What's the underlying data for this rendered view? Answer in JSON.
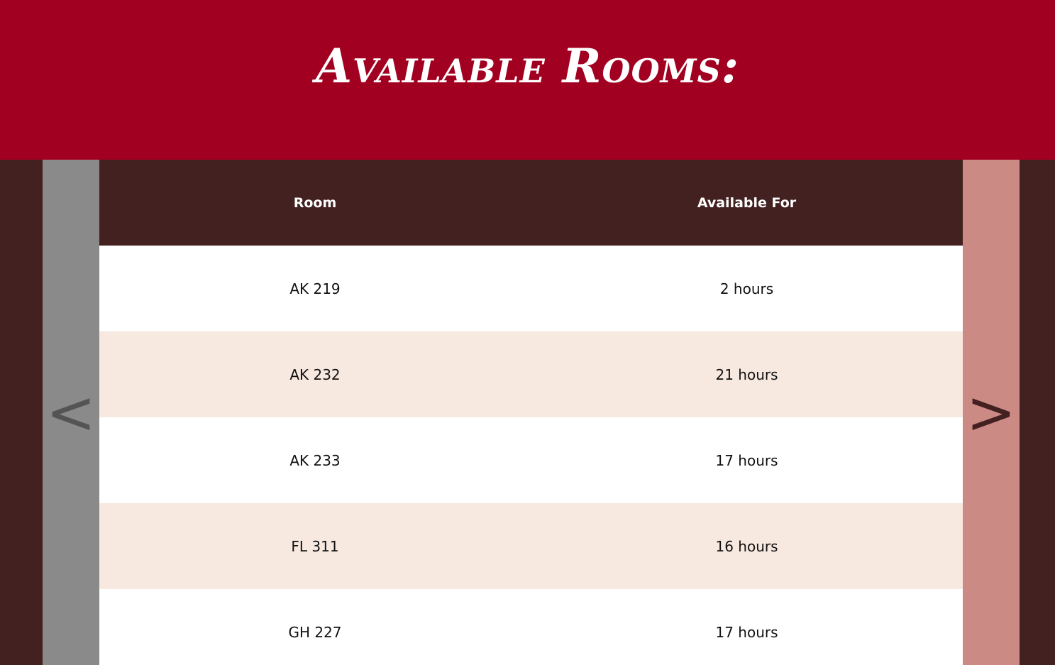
{
  "header": {
    "title": "Available Rooms:"
  },
  "nav": {
    "prev_glyph": "<",
    "next_glyph": ">"
  },
  "table": {
    "columns": [
      "Room",
      "Available For"
    ],
    "rows": [
      {
        "room": "AK 219",
        "available_for": "2 hours"
      },
      {
        "room": "AK 232",
        "available_for": "21 hours"
      },
      {
        "room": "AK 233",
        "available_for": "17 hours"
      },
      {
        "room": "FL 311",
        "available_for": "16 hours"
      },
      {
        "room": "GH 227",
        "available_for": "17 hours"
      }
    ]
  },
  "colors": {
    "header_bg": "#a20020",
    "page_bg": "#432121",
    "prev_button_bg": "#8a8a8a",
    "next_button_bg": "#cc8a85",
    "row_alt_bg": "#f7e8e0"
  }
}
